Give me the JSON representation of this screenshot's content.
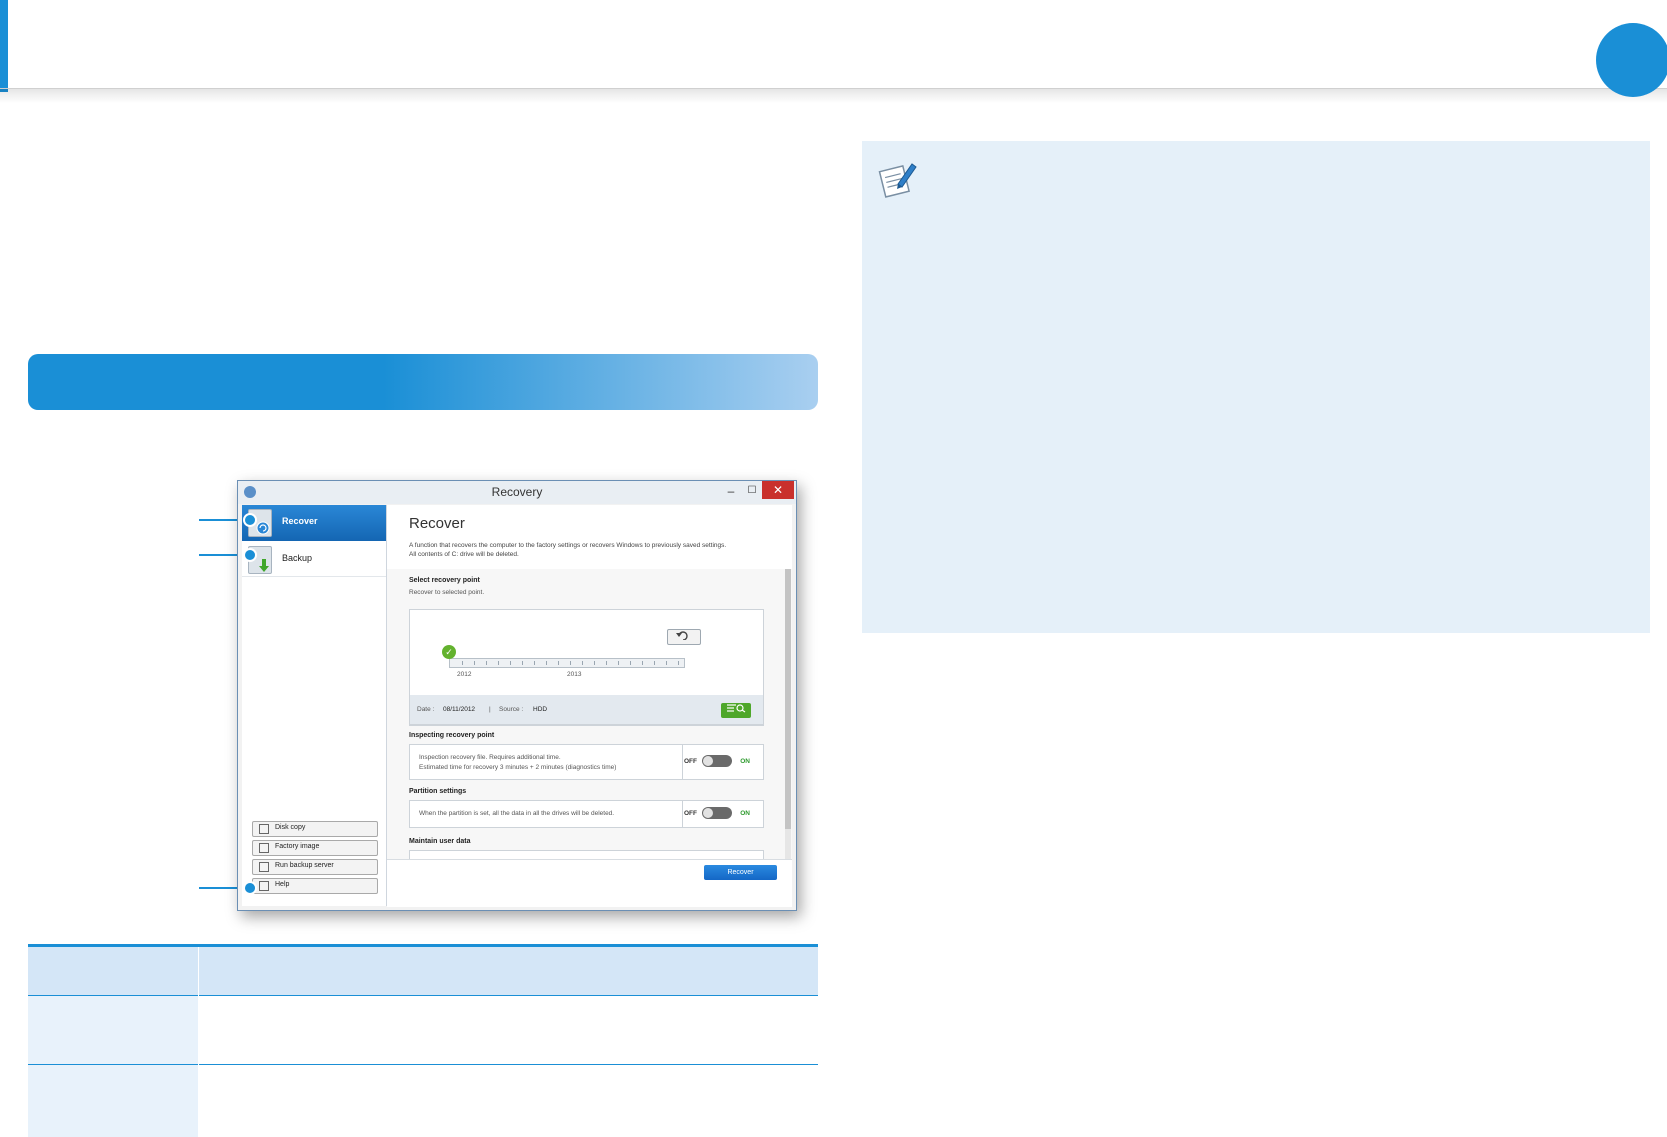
{
  "window": {
    "title": "Recovery",
    "minimize_glyph": "–",
    "maximize_glyph": "☐",
    "close_glyph": "✕"
  },
  "sidebar": {
    "items": [
      {
        "label": "Recover",
        "icon": "recover-icon"
      },
      {
        "label": "Backup",
        "icon": "backup-icon"
      }
    ],
    "buttons": [
      {
        "label": "Disk copy",
        "icon": "disk-copy-icon"
      },
      {
        "label": "Factory image",
        "icon": "factory-image-icon"
      },
      {
        "label": "Run backup server",
        "icon": "backup-server-icon"
      },
      {
        "label": "Help",
        "icon": "help-icon"
      }
    ]
  },
  "content": {
    "title": "Recover",
    "desc_line1": "A function that recovers the computer to the factory settings or recovers Windows to previously saved settings.",
    "desc_line2": "All contents of C: drive will be deleted.",
    "select_heading": "Select recovery point",
    "select_sub": "Recover to selected point.",
    "timeline_years": [
      "2012",
      "2013"
    ],
    "date_label": "Date :",
    "date_value": "08/11/2012",
    "separator": "|",
    "source_label": "Source :",
    "source_value": "HDD",
    "inspect_heading": "Inspecting recovery point",
    "inspect_line1": "Inspection recovery file. Requires additional time.",
    "inspect_line2": "Estimated time for recovery 3 minutes + 2 minutes (diagnostics time)",
    "partition_heading": "Partition settings",
    "partition_line": "When the partition is set, all the data in all the drives will be deleted.",
    "maintain_heading": "Maintain user data",
    "off_label": "OFF",
    "on_label": "ON",
    "inspect_toggle_on": false,
    "partition_toggle_on": false,
    "recover_button": "Recover"
  },
  "colors": {
    "accent": "#1a8fd6",
    "note_bg": "#e5f0f9",
    "table_head": "#d4e6f7",
    "close": "#c9302c",
    "green": "#4ea72a"
  },
  "icons": {
    "note": "note-pencil-icon",
    "undo": "undo-icon",
    "search_list": "search-list-icon"
  }
}
